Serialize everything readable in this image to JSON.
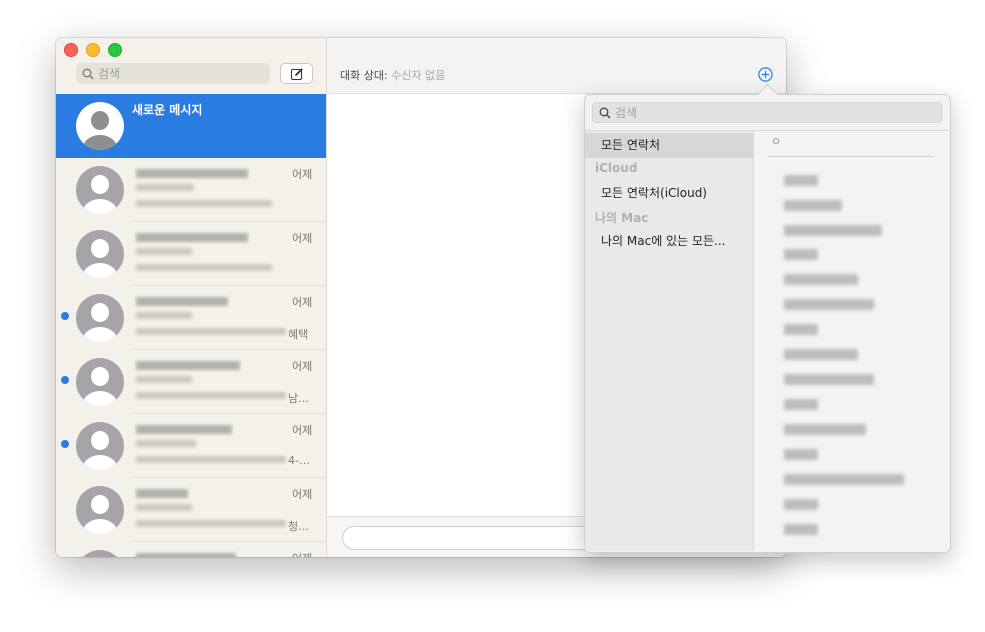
{
  "window": {
    "sidebar": {
      "search_placeholder": "검색",
      "new_message_title": "새로운 메시지",
      "conversations": [
        {
          "time": "어제",
          "snippet_tail": "",
          "unread": false
        },
        {
          "time": "어제",
          "snippet_tail": "",
          "unread": false
        },
        {
          "time": "어제",
          "snippet_tail": "혜택",
          "unread": true
        },
        {
          "time": "어제",
          "snippet_tail": "남…",
          "unread": true
        },
        {
          "time": "어제",
          "snippet_tail": "4-…",
          "unread": true
        },
        {
          "time": "어제",
          "snippet_tail": "청…",
          "unread": false
        },
        {
          "time": "어제",
          "snippet_tail": "",
          "unread": false
        }
      ]
    },
    "header": {
      "to_label": "대화 상대:",
      "to_placeholder": "수신자 없음"
    }
  },
  "contacts_popover": {
    "search_placeholder": "검색",
    "groups": {
      "all_contacts": "모든 연락처",
      "icloud_header": "iCloud",
      "all_icloud": "모든 연락처(iCloud)",
      "mac_header": "나의 Mac",
      "all_mac": "나의 Mac에 있는 모든..."
    },
    "index_letter": "ㅇ"
  },
  "colors": {
    "accent": "#2a7ce2",
    "sidebar_bg": "#f4f1ea",
    "unread_dot": "#2a7ce2"
  }
}
